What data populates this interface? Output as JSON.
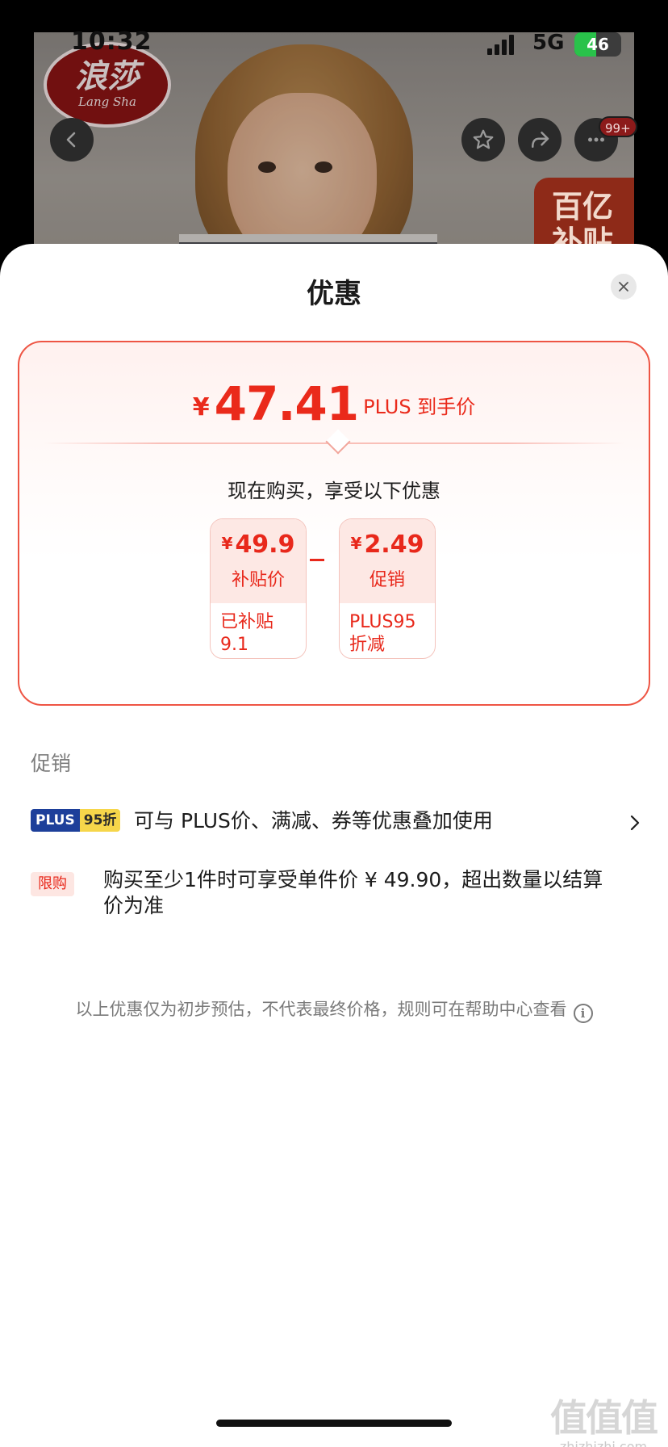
{
  "status_bar": {
    "time": "10:32",
    "network": "5G",
    "battery": "46",
    "battery_level": 0.46
  },
  "product_page": {
    "brand_logo_cn": "浪莎",
    "brand_logo_en": "Lang Sha",
    "message_badge": "99+",
    "subsidy_badge": "百亿补贴",
    "icons": [
      "back-arrow-icon",
      "star-icon",
      "share-icon",
      "more-icon"
    ]
  },
  "sheet": {
    "title": "优惠",
    "close_icon": "close-icon"
  },
  "price_card": {
    "currency": "¥",
    "final_price": "47.41",
    "final_label": "PLUS 到手价",
    "subtitle": "现在购买，享受以下优惠",
    "operator": "－",
    "components": [
      {
        "currency": "¥",
        "amount": "49.9",
        "name": "补贴价",
        "note": "已补贴 9.1"
      },
      {
        "currency": "¥",
        "amount": "2.49",
        "name": "促销",
        "note": "PLUS95 折减 2.49"
      }
    ],
    "accent_color": "#e8281b"
  },
  "promotions": {
    "heading": "促销",
    "plus_row": {
      "tag_left": "PLUS",
      "tag_right": "95折",
      "text": "可与 PLUS价、满减、券等优惠叠加使用",
      "chevron": "›"
    },
    "limit_row": {
      "tag": "限购",
      "text": "购买至少1件时可享受单件价 ¥ 49.90，超出数量以结算价为准"
    }
  },
  "disclaimer": "以上优惠仅为初步预估，不代表最终价格，规则可在帮助中心查看",
  "watermark": {
    "main": "值值值",
    "url": "zhizhizhi.com"
  }
}
